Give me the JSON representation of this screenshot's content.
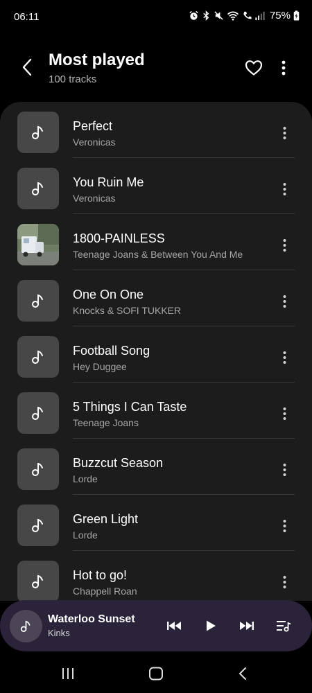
{
  "status_bar": {
    "time": "06:11",
    "battery": "75%",
    "icons": [
      "alarm-icon",
      "bluetooth-icon",
      "mute-icon",
      "wifi-icon",
      "call-icon",
      "signal-icon",
      "battery-icon"
    ]
  },
  "header": {
    "title": "Most played",
    "subtitle": "100 tracks"
  },
  "tracks": [
    {
      "title": "Perfect",
      "artist": "Veronicas",
      "has_art": false
    },
    {
      "title": "You Ruin Me",
      "artist": "Veronicas",
      "has_art": false
    },
    {
      "title": "1800-PAINLESS",
      "artist": "Teenage Joans & Between You And Me",
      "has_art": true
    },
    {
      "title": "One On One",
      "artist": "Knocks & SOFI TUKKER",
      "has_art": false
    },
    {
      "title": "Football Song",
      "artist": "Hey Duggee",
      "has_art": false
    },
    {
      "title": "5 Things I Can Taste",
      "artist": "Teenage Joans",
      "has_art": false
    },
    {
      "title": "Buzzcut Season",
      "artist": "Lorde",
      "has_art": false
    },
    {
      "title": "Green Light",
      "artist": "Lorde",
      "has_art": false
    },
    {
      "title": "Hot to go!",
      "artist": "Chappell Roan",
      "has_art": false
    }
  ],
  "now_playing": {
    "title": "Waterloo Sunset",
    "artist": "Kinks"
  },
  "colors": {
    "background": "#000000",
    "list_panel": "#1c1c1c",
    "thumb": "#474747",
    "mini_player": "#2b2339",
    "secondary_text": "#a6a6a6"
  }
}
